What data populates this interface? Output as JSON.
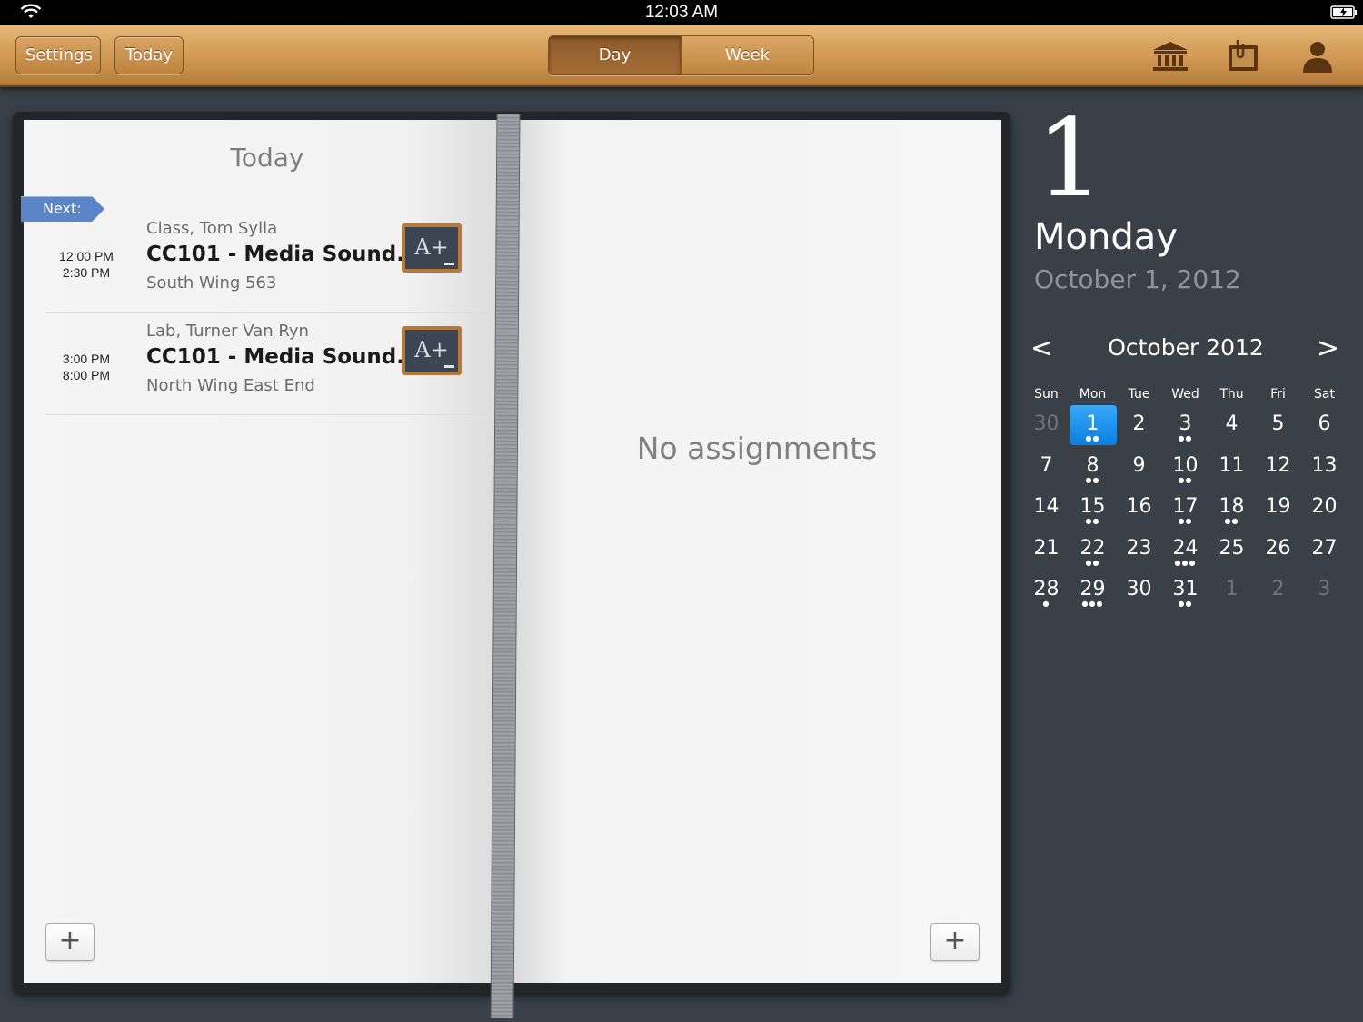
{
  "status_bar": {
    "time": "12:03 AM"
  },
  "toolbar": {
    "settings_label": "Settings",
    "today_label": "Today",
    "segments": [
      {
        "label": "Day",
        "active": true
      },
      {
        "label": "Week",
        "active": false
      }
    ],
    "icons": [
      "institution-icon",
      "notes-icon",
      "profile-icon"
    ]
  },
  "left_page": {
    "title": "Today",
    "next_tag": "Next:",
    "events": [
      {
        "start": "12:00 PM",
        "end": "2:30 PM",
        "meta": "Class, Tom Sylla",
        "title": "CC101 - Media Sound...",
        "place": "South Wing 563"
      },
      {
        "start": "3:00 PM",
        "end": "8:00 PM",
        "meta": "Lab, Turner Van Ryn",
        "title": "CC101 - Media Sound...",
        "place": "North Wing East End"
      }
    ],
    "add_label": "+"
  },
  "right_page": {
    "empty_text": "No assignments",
    "add_label": "+"
  },
  "side_panel": {
    "day_number": "1",
    "weekday": "Monday",
    "full_date": "October 1, 2012",
    "calendar": {
      "month_label": "October 2012",
      "prev": "<",
      "next": ">",
      "weekdays": [
        "Sun",
        "Mon",
        "Tue",
        "Wed",
        "Thu",
        "Fri",
        "Sat"
      ],
      "weeks": [
        [
          {
            "d": "30",
            "muted": true,
            "dots": 0
          },
          {
            "d": "1",
            "selected": true,
            "dots": 2
          },
          {
            "d": "2",
            "dots": 0
          },
          {
            "d": "3",
            "dots": 2
          },
          {
            "d": "4",
            "dots": 0
          },
          {
            "d": "5",
            "dots": 0
          },
          {
            "d": "6",
            "dots": 0
          }
        ],
        [
          {
            "d": "7",
            "dots": 0
          },
          {
            "d": "8",
            "dots": 2
          },
          {
            "d": "9",
            "dots": 0
          },
          {
            "d": "10",
            "dots": 2
          },
          {
            "d": "11",
            "dots": 0
          },
          {
            "d": "12",
            "dots": 0
          },
          {
            "d": "13",
            "dots": 0
          }
        ],
        [
          {
            "d": "14",
            "dots": 0
          },
          {
            "d": "15",
            "dots": 2
          },
          {
            "d": "16",
            "dots": 0
          },
          {
            "d": "17",
            "dots": 2
          },
          {
            "d": "18",
            "dots": 2
          },
          {
            "d": "19",
            "dots": 0
          },
          {
            "d": "20",
            "dots": 0
          }
        ],
        [
          {
            "d": "21",
            "dots": 0
          },
          {
            "d": "22",
            "dots": 2
          },
          {
            "d": "23",
            "dots": 0
          },
          {
            "d": "24",
            "dots": 3
          },
          {
            "d": "25",
            "dots": 0
          },
          {
            "d": "26",
            "dots": 0
          },
          {
            "d": "27",
            "dots": 0
          }
        ],
        [
          {
            "d": "28",
            "dots": 1
          },
          {
            "d": "29",
            "dots": 3
          },
          {
            "d": "30",
            "dots": 0
          },
          {
            "d": "31",
            "dots": 2
          },
          {
            "d": "1",
            "muted": true,
            "dots": 0
          },
          {
            "d": "2",
            "muted": true,
            "dots": 0
          },
          {
            "d": "3",
            "muted": true,
            "dots": 0
          }
        ]
      ]
    }
  },
  "colors": {
    "selected_day": "#1a8fee",
    "next_tag": "#5a86c9",
    "wood": "#c98f4b",
    "chalkboard": "#3a4048"
  }
}
